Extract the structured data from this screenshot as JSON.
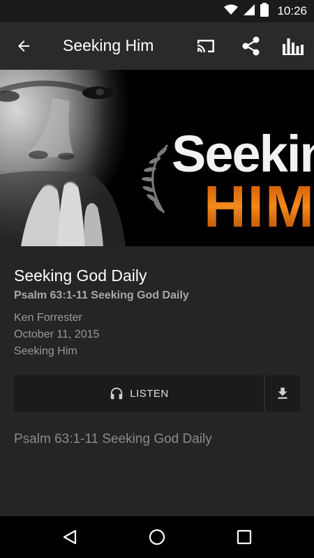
{
  "status_bar": {
    "time": "10:26",
    "icons": [
      "wifi-icon",
      "signal-icon",
      "battery-icon"
    ]
  },
  "app_bar": {
    "title": "Seeking Him",
    "actions": [
      "cast-icon",
      "share-icon",
      "bar-chart-icon"
    ]
  },
  "hero": {
    "line1": "Seekin",
    "line2": "HIM"
  },
  "episode": {
    "title": "Seeking God Daily",
    "subtitle": "Psalm 63:1-11  Seeking God Daily",
    "speaker": "Ken Forrester",
    "date": "October 11, 2015",
    "series": "Seeking Him"
  },
  "actions": {
    "listen_label": "LISTEN"
  },
  "description": "Psalm 63:1-11  Seeking God Daily",
  "colors": {
    "background": "#252525",
    "app_bar": "#2a2a2a",
    "button": "#1b1b1b",
    "accent": "#e87a12"
  }
}
